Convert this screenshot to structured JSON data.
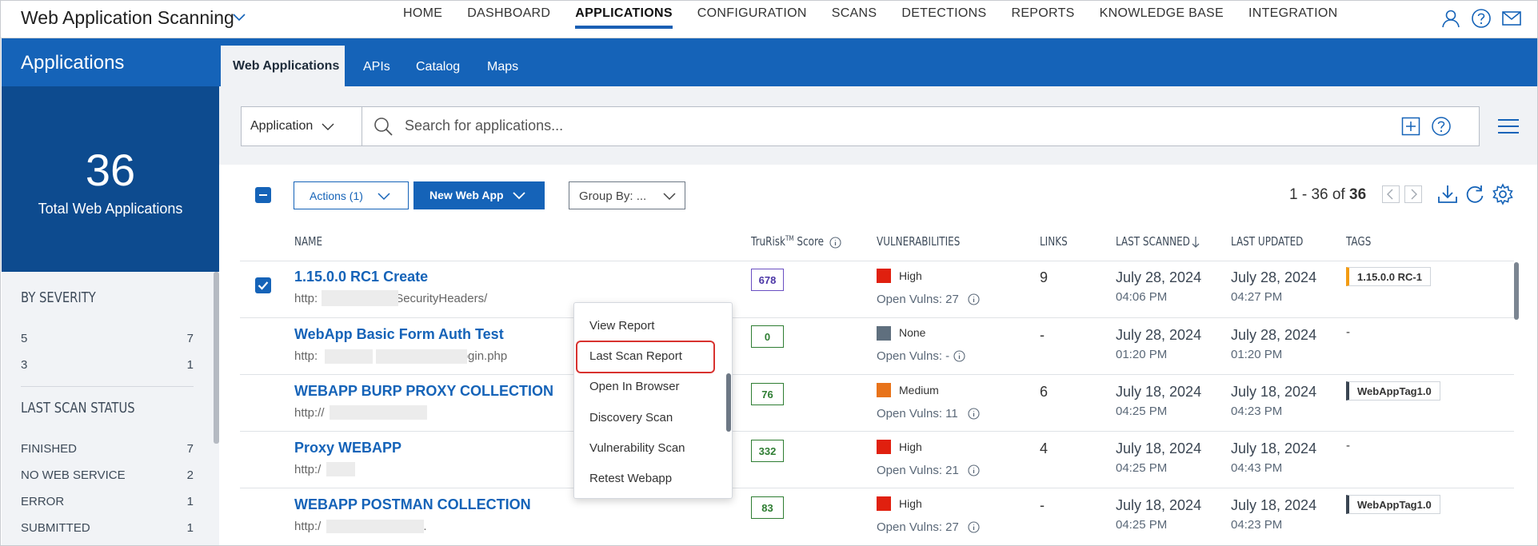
{
  "app": {
    "title": "Web Application Scanning"
  },
  "nav": [
    "HOME",
    "DASHBOARD",
    "APPLICATIONS",
    "CONFIGURATION",
    "SCANS",
    "DETECTIONS",
    "REPORTS",
    "KNOWLEDGE BASE",
    "INTEGRATION"
  ],
  "nav_active": "APPLICATIONS",
  "left": {
    "title": "Applications",
    "total": "36",
    "total_label": "Total Web Applications",
    "severity_heading": "BY SEVERITY",
    "severity": [
      {
        "label": "5",
        "count": "7"
      },
      {
        "label": "3",
        "count": "1"
      }
    ],
    "status_heading": "LAST SCAN STATUS",
    "status": [
      {
        "label": "FINISHED",
        "count": "7"
      },
      {
        "label": "NO WEB SERVICE",
        "count": "2"
      },
      {
        "label": "ERROR",
        "count": "1"
      },
      {
        "label": "SUBMITTED",
        "count": "1"
      }
    ]
  },
  "tabs": [
    "Web Applications",
    "APIs",
    "Catalog",
    "Maps"
  ],
  "search": {
    "scope": "Application",
    "placeholder": "Search for applications..."
  },
  "toolbar": {
    "actions": "Actions (1)",
    "new": "New Web App",
    "group_by": "Group By: ...",
    "range": "1 - 36 of",
    "total": "36"
  },
  "columns": {
    "name": "NAME",
    "trurisk": "TruRisk",
    "trurisk_tm": "TM",
    "trurisk_suffix": " Score",
    "vulns": "VULNERABILITIES",
    "links": "LINKS",
    "last_scanned": "LAST SCANNED",
    "last_updated": "LAST UPDATED",
    "tags": "TAGS"
  },
  "rows": [
    {
      "name": "1.15.0.0 RC1 Create",
      "url_start": "http:",
      "url_end": "SecurityHeaders/",
      "score": "678",
      "severity": "High",
      "severity_color": "#e0200f",
      "open_vulns": "Open Vulns: 27",
      "links": "9",
      "scanned_date": "July 28, 2024",
      "scanned_time": "04:06 PM",
      "updated_date": "July 28, 2024",
      "updated_time": "04:27 PM",
      "tag": "1.15.0.0 RC-1",
      "tag_color": "#f39c12",
      "selected": true
    },
    {
      "name": "WebApp Basic Form Auth Test",
      "url_start": "http:",
      "url_end": "/login.php",
      "score": "0",
      "severity": "None",
      "severity_color": "#5f6f7e",
      "open_vulns": "Open Vulns: -",
      "links": "-",
      "scanned_date": "July 28, 2024",
      "scanned_time": "01:20 PM",
      "updated_date": "July 28, 2024",
      "updated_time": "01:20 PM",
      "tag": "-",
      "tag_color": "",
      "selected": false
    },
    {
      "name": "WEBAPP BURP PROXY COLLECTION",
      "url_start": "http://",
      "url_end": "",
      "score": "76",
      "severity": "Medium",
      "severity_color": "#e8731a",
      "open_vulns": "Open Vulns: 11",
      "links": "6",
      "scanned_date": "July 18, 2024",
      "scanned_time": "04:25 PM",
      "updated_date": "July 18, 2024",
      "updated_time": "04:23 PM",
      "tag": "WebAppTag1.0",
      "tag_color": "#3a4552",
      "selected": false
    },
    {
      "name": "Proxy WEBAPP",
      "url_start": "http:/",
      "url_end": "",
      "score": "332",
      "severity": "High",
      "severity_color": "#e0200f",
      "open_vulns": "Open Vulns: 21",
      "links": "4",
      "scanned_date": "July 18, 2024",
      "scanned_time": "04:25 PM",
      "updated_date": "July 18, 2024",
      "updated_time": "04:43 PM",
      "tag": "-",
      "tag_color": "",
      "selected": false
    },
    {
      "name": "WEBAPP POSTMAN COLLECTION",
      "url_start": "http:/",
      "url_end": ".",
      "score": "83",
      "severity": "High",
      "severity_color": "#e0200f",
      "open_vulns": "Open Vulns: 27",
      "links": "-",
      "scanned_date": "July 18, 2024",
      "scanned_time": "04:25 PM",
      "updated_date": "July 18, 2024",
      "updated_time": "04:23 PM",
      "tag": "WebAppTag1.0",
      "tag_color": "#3a4552",
      "selected": false
    }
  ],
  "context_menu": [
    "View Report",
    "Last Scan Report",
    "Open In Browser",
    "Discovery Scan",
    "Vulnerability Scan",
    "Retest Webapp"
  ],
  "context_menu_highlighted": "Last Scan Report",
  "colors": {
    "brand": "#1563b8",
    "brand_dark": "#0d4b8f",
    "highlight": "#d8322f"
  }
}
